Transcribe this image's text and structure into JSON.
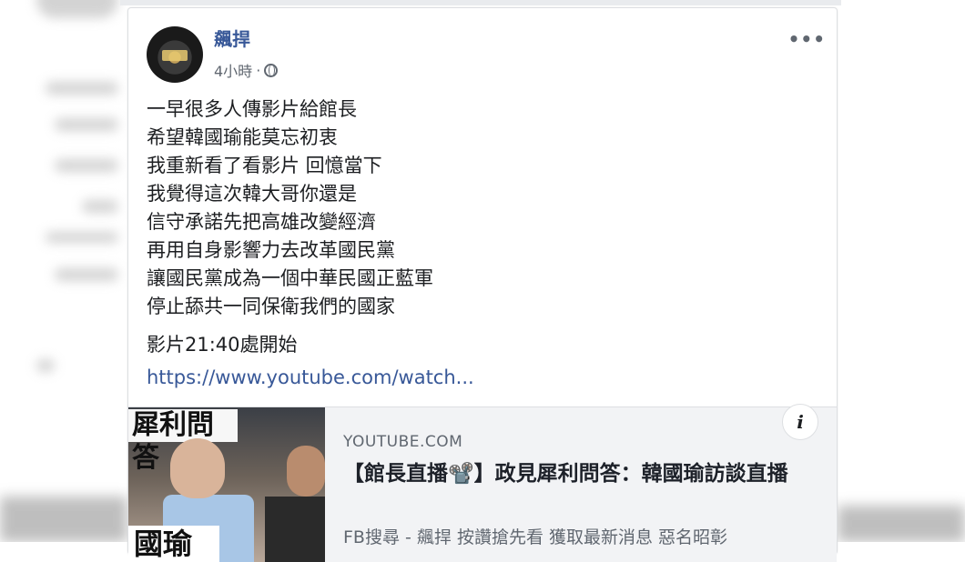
{
  "post": {
    "author": "飆捍",
    "time": "4小時",
    "separator": "·",
    "more_label": "•••",
    "lines": [
      "一早很多人傳影片給館長",
      "希望韓國瑜能莫忘初衷",
      "我重新看了看影片 回憶當下",
      "我覺得這次韓大哥你還是",
      "信守承諾先把高雄改變經濟",
      "再用自身影響力去改革國民黨",
      "讓國民黨成為一個中華民國正藍軍",
      "停止舔共一同保衛我們的國家"
    ],
    "video_start": "影片21:40處開始",
    "link": "https://www.youtube.com/watch..."
  },
  "preview": {
    "domain": "YOUTUBE.COM",
    "title": "【館長直播📽️】政見犀利問答：韓國瑜訪談直播",
    "description": "FB搜尋 - 飆捍 按讚搶先看 獲取最新消息 惡名昭彰",
    "info_label": "i",
    "thumb_banner": "犀利問答",
    "thumb_caption": "國瑜"
  },
  "icons": {
    "privacy": "globe-icon",
    "info": "info-icon",
    "more": "more-options-icon"
  }
}
